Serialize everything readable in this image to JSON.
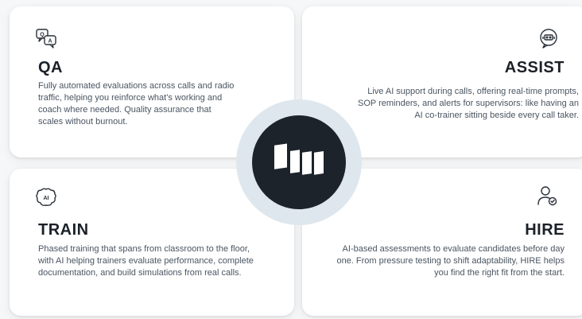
{
  "cards": {
    "qa": {
      "icon": "qa-chat-bubbles-icon",
      "title": "QA",
      "description": "Fully automated evaluations across calls and radio traffic, helping you reinforce what's working and coach where needed. Quality assurance that scales without burnout."
    },
    "assist": {
      "icon": "assist-support-chat-icon",
      "title": "ASSIST",
      "description": "Live AI support during calls, offering real-time prompts, SOP reminders, and alerts for supervisors: like having an AI co-trainer sitting beside every call taker."
    },
    "train": {
      "icon": "ai-brain-icon",
      "title": "TRAIN",
      "description": "Phased training that spans from classroom to the floor, with AI helping trainers evaluate performance, complete documentation, and build simulations from real calls."
    },
    "hire": {
      "icon": "user-check-icon",
      "title": "HIRE",
      "description": "AI-based assessments to evaluate candidates before day one. From pressure testing to shift adaptability, HIRE helps you find the right fit from the start."
    }
  },
  "hub": {
    "logo": "brand-blocks-logo",
    "colors": {
      "ring": "#dfe7ee",
      "core": "#1d232b",
      "logo": "#ffffff"
    }
  },
  "colors": {
    "background": "#f6f7f8",
    "card": "#ffffff",
    "title": "#1b2129",
    "text": "#4a5561"
  }
}
